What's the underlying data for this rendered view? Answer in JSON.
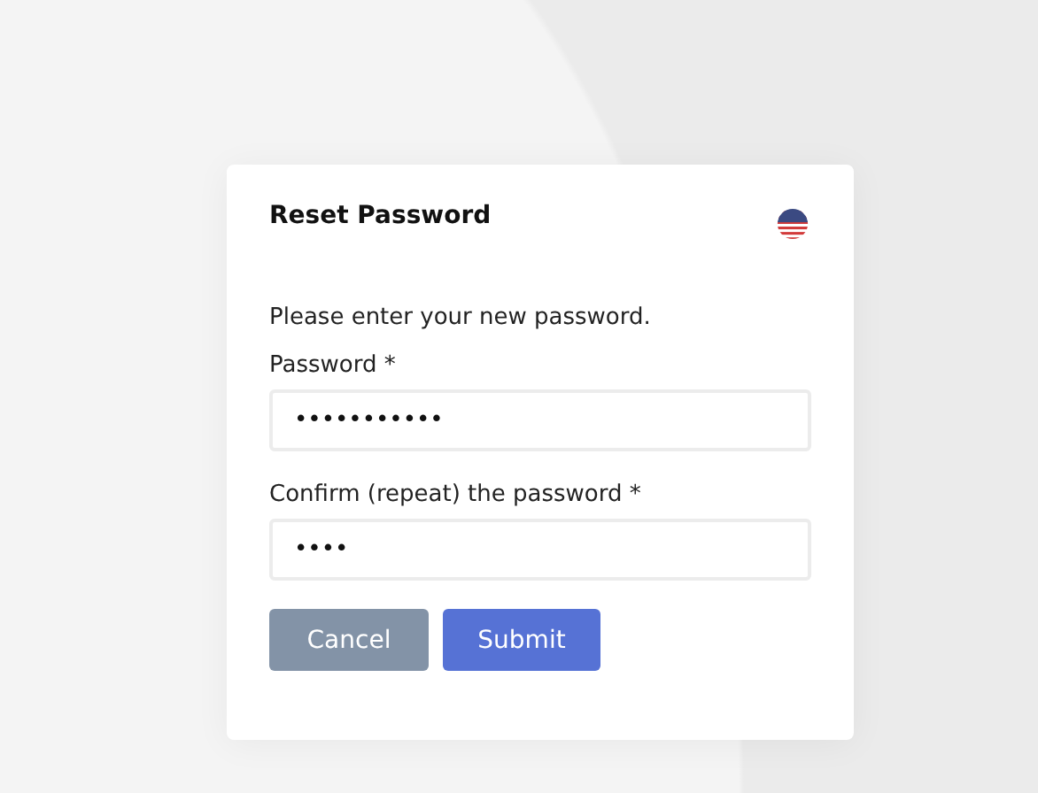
{
  "dialog": {
    "title": "Reset Password",
    "instruction": "Please enter your new password.",
    "fields": [
      {
        "label": "Password *",
        "value": "•••••••••••"
      },
      {
        "label": "Confirm (repeat) the password *",
        "value": "••••"
      }
    ],
    "buttons": [
      {
        "label": "Cancel",
        "kind": "secondary"
      },
      {
        "label": "Submit",
        "kind": "primary"
      }
    ]
  }
}
